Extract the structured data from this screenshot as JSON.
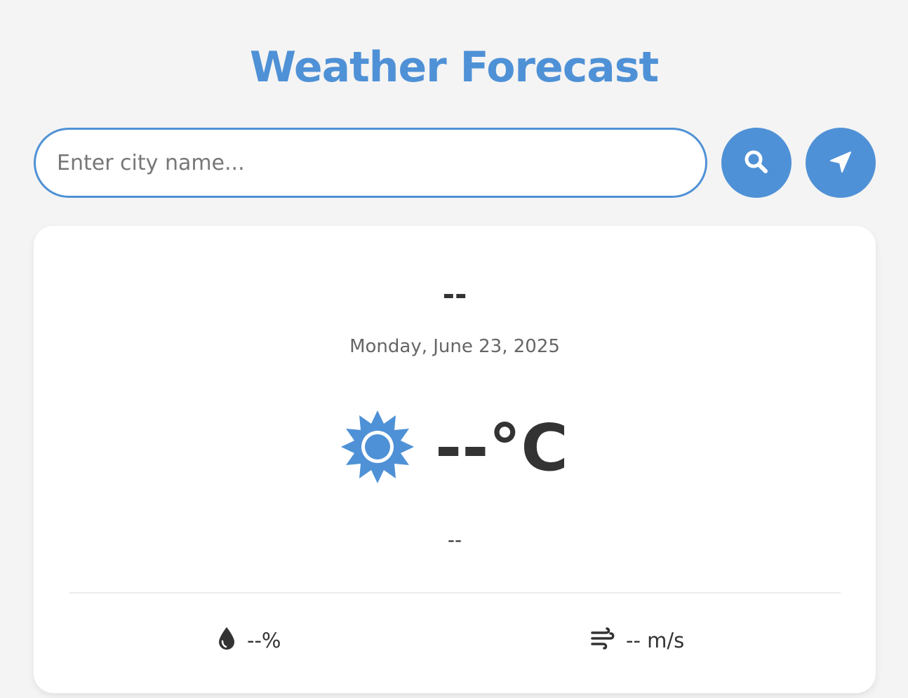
{
  "header": {
    "title": "Weather Forecast"
  },
  "search": {
    "placeholder": "Enter city name...",
    "value": ""
  },
  "icons": {
    "search": "search-icon",
    "location": "location-arrow-icon",
    "weather": "sun-icon",
    "humidity": "water-drop-icon",
    "wind": "wind-icon"
  },
  "weather": {
    "city": "--",
    "date": "Monday, June 23, 2025",
    "temperature": "--°C",
    "description": "--",
    "humidity": "--%",
    "wind": "-- m/s"
  },
  "colors": {
    "accent": "#4f91d6",
    "background": "#f4f4f4",
    "card": "#ffffff",
    "text": "#333333"
  }
}
